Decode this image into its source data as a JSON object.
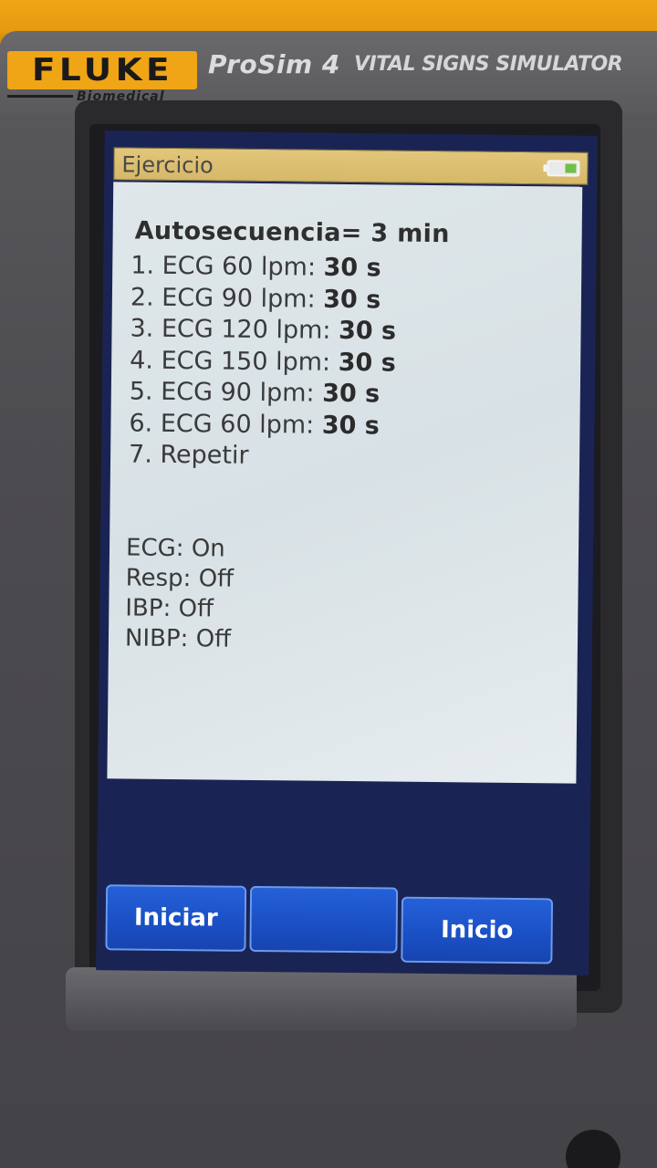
{
  "device": {
    "brand": "FLUKE",
    "brand_sub": "Biomedical",
    "model": "ProSim 4",
    "description": "VITAL SIGNS SIMULATOR"
  },
  "screen": {
    "title": "Ejercicio",
    "battery_icon": "battery-icon",
    "heading": "Autosecuencia= 3 min",
    "steps": [
      {
        "label": "1. ECG 60 lpm: ",
        "duration": "30 s"
      },
      {
        "label": "2. ECG 90 lpm: ",
        "duration": "30 s"
      },
      {
        "label": "3. ECG 120 lpm: ",
        "duration": "30 s"
      },
      {
        "label": "4. ECG 150 lpm: ",
        "duration": "30 s"
      },
      {
        "label": "5. ECG 90 lpm: ",
        "duration": "30 s"
      },
      {
        "label": "6. ECG 60 lpm: ",
        "duration": "30 s"
      },
      {
        "label": "7. Repetir",
        "duration": ""
      }
    ],
    "status": [
      "ECG: On",
      "Resp: Off",
      "IBP: Off",
      "NIBP: Off"
    ]
  },
  "softkeys": {
    "left": "Iniciar",
    "middle": "",
    "right": "Inicio"
  },
  "colors": {
    "titlebar": "#d6b868",
    "content_bg": "#dfe7ea",
    "softkey": "#1a4fc4",
    "screen_bg": "#1a2454",
    "brand_yellow": "#f0a516"
  }
}
